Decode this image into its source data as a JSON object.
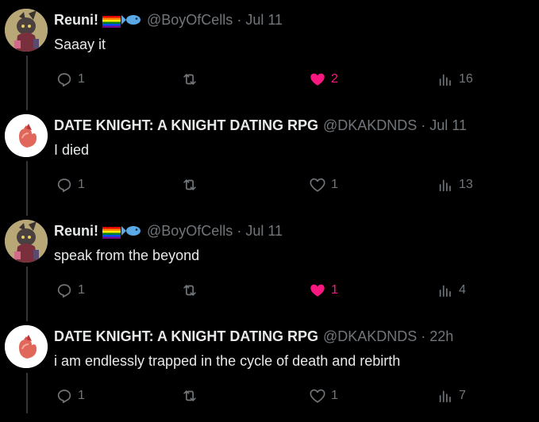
{
  "tweets": [
    {
      "name": "Reuni!",
      "handle": "@BoyOfCells",
      "separator": "·",
      "time": "Jul 11",
      "text": "Saaay it",
      "replies": "1",
      "likes": "2",
      "liked": true,
      "views": "16"
    },
    {
      "name": "DATE KNIGHT: A KNIGHT DATING RPG",
      "handle": "@DKAKDNDS",
      "separator": "·",
      "time": "Jul 11",
      "text": "I died",
      "replies": "1",
      "likes": "1",
      "liked": false,
      "views": "13"
    },
    {
      "name": "Reuni!",
      "handle": "@BoyOfCells",
      "separator": "·",
      "time": "Jul 11",
      "text": "speak from the beyond",
      "replies": "1",
      "likes": "1",
      "liked": true,
      "views": "4"
    },
    {
      "name": "DATE KNIGHT: A KNIGHT DATING RPG",
      "handle": "@DKAKDNDS",
      "separator": "·",
      "time": "22h",
      "text": "i am endlessly trapped in the cycle of death and rebirth",
      "replies": "1",
      "likes": "1",
      "liked": false,
      "views": "7"
    }
  ],
  "colors": {
    "background": "#000000",
    "text": "#e7e9ea",
    "muted": "#71767b",
    "like_active": "#f91880",
    "thread_line": "#333639"
  },
  "icons": [
    "reply-icon",
    "retweet-icon",
    "like-icon",
    "views-icon",
    "pride-flag-icon",
    "fish-icon"
  ]
}
